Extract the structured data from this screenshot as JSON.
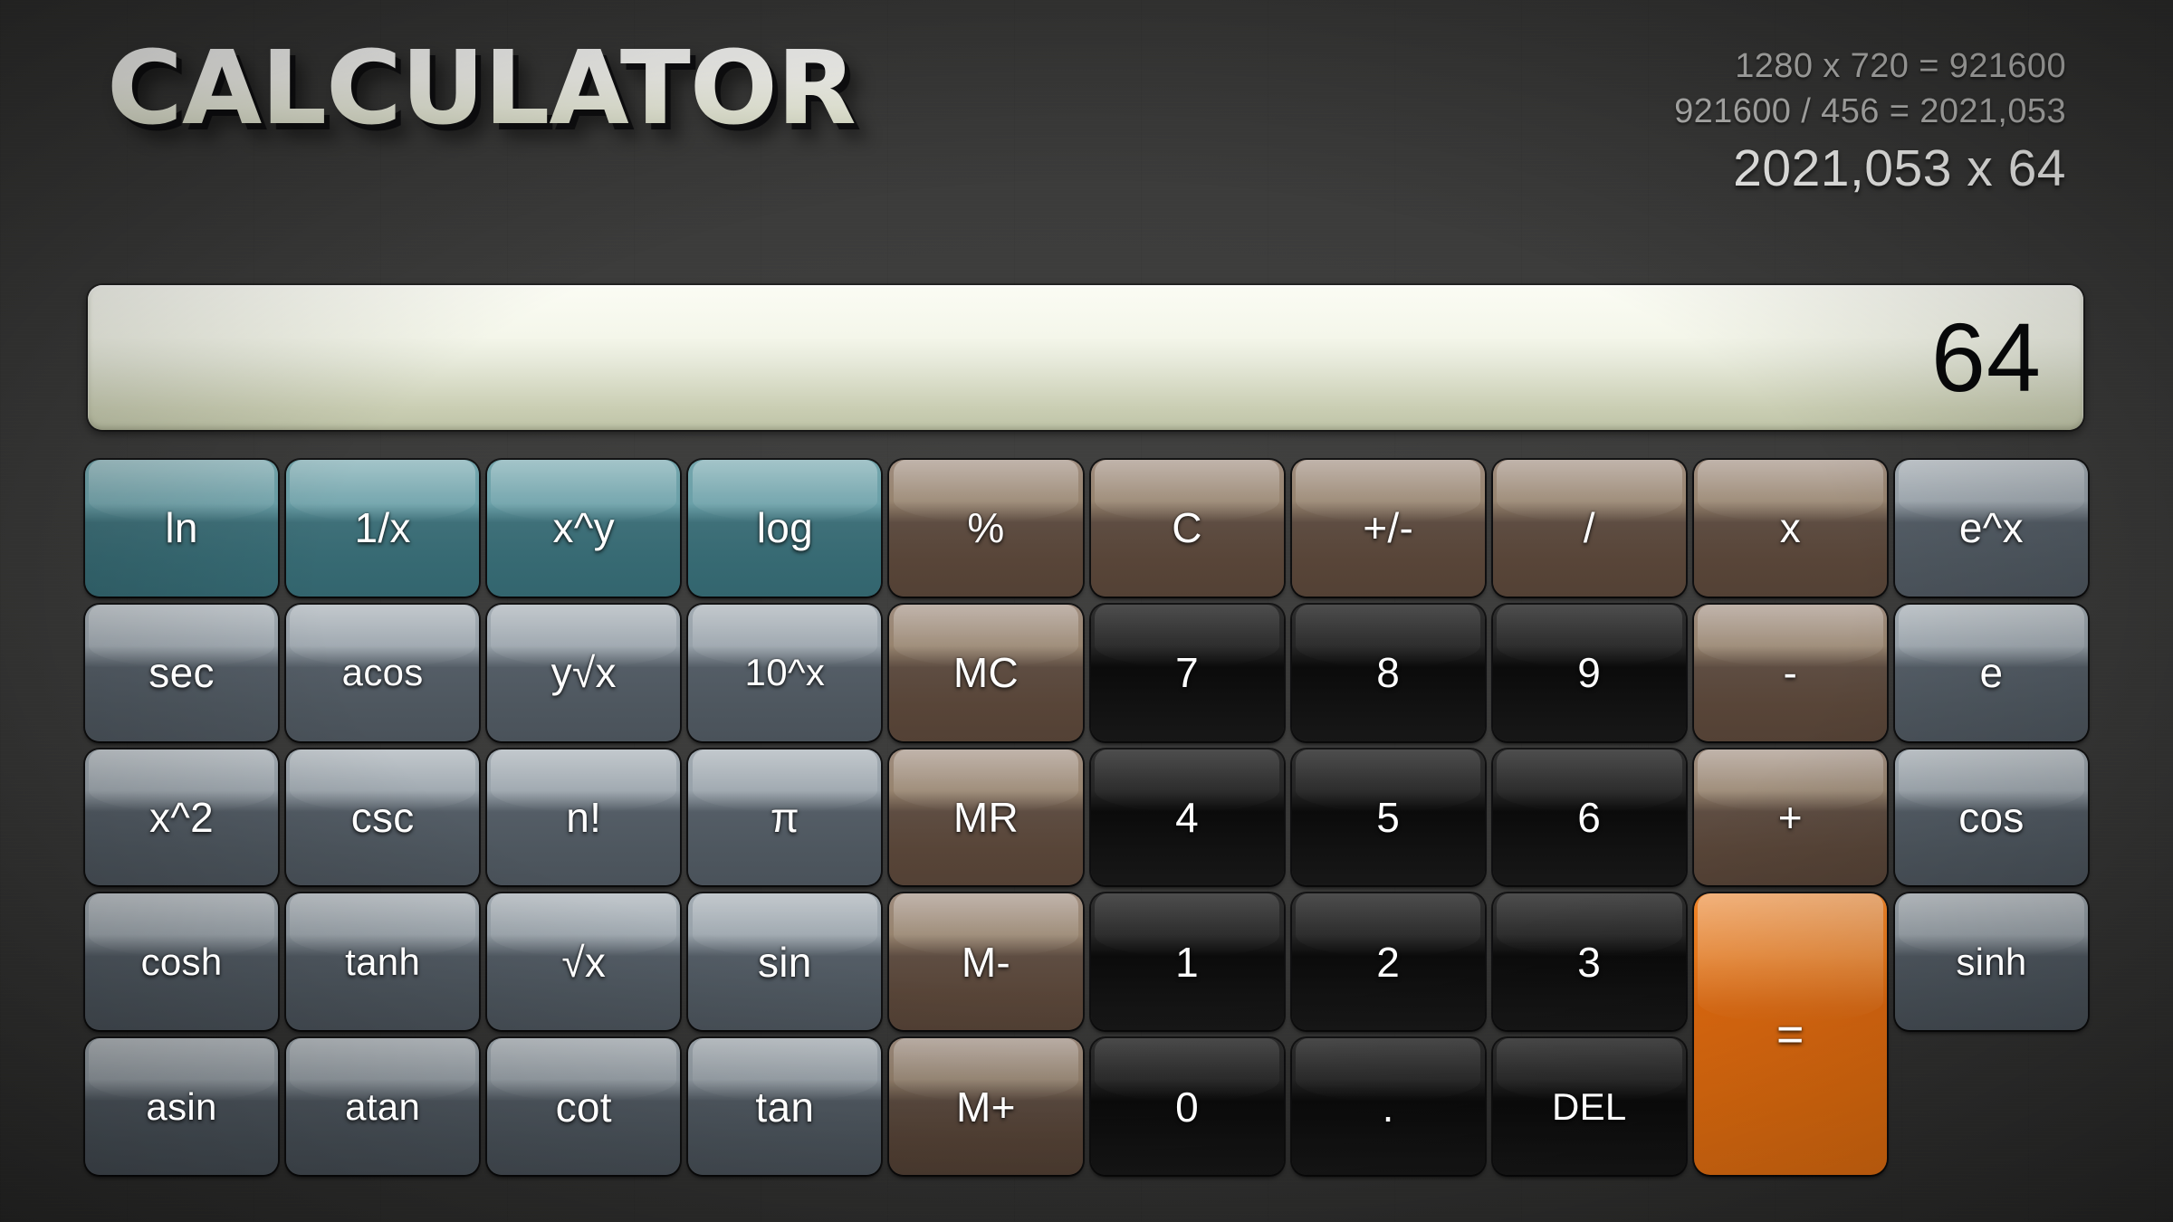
{
  "header": {
    "title": "CALCULATOR",
    "history": [
      "1280 x 720 = 921600",
      "921600 / 456 = 2021,053"
    ],
    "current_expression": "2021,053 x 64"
  },
  "display": {
    "value": "64"
  },
  "colors": {
    "background": "#3a3a39",
    "display_light": "#fbfcf4",
    "display_dark": "#bfc4a8",
    "teal": "#3f7079",
    "brown": "#5e4d42",
    "slate": "#545d66",
    "dark": "#111111",
    "orange": "#ef7411",
    "key_text": "#ffffff"
  },
  "keypad": {
    "rows": [
      [
        {
          "label": "ln",
          "name": "key-ln",
          "style": "teal"
        },
        {
          "label": "1/x",
          "name": "key-reciprocal",
          "style": "teal"
        },
        {
          "label": "x^y",
          "name": "key-power",
          "style": "teal"
        },
        {
          "label": "log",
          "name": "key-log",
          "style": "teal"
        },
        {
          "label": "%",
          "name": "key-percent",
          "style": "brown"
        },
        {
          "label": "C",
          "name": "key-clear",
          "style": "brown"
        },
        {
          "label": "+/-",
          "name": "key-sign",
          "style": "brown"
        },
        {
          "label": "/",
          "name": "key-divide",
          "style": "brown"
        },
        {
          "label": "x",
          "name": "key-multiply",
          "style": "brown"
        }
      ],
      [
        {
          "label": "e^x",
          "name": "key-exp",
          "style": "slate"
        },
        {
          "label": "sec",
          "name": "key-sec",
          "style": "slate"
        },
        {
          "label": "acos",
          "name": "key-acos",
          "style": "slate",
          "small": true
        },
        {
          "label": "y√x",
          "name": "key-nth-root",
          "style": "slate"
        },
        {
          "label": "10^x",
          "name": "key-ten-power",
          "style": "slate",
          "small": true
        },
        {
          "label": "MC",
          "name": "key-memory-clear",
          "style": "brown"
        },
        {
          "label": "7",
          "name": "key-7",
          "style": "dark"
        },
        {
          "label": "8",
          "name": "key-8",
          "style": "dark"
        },
        {
          "label": "9",
          "name": "key-9",
          "style": "dark"
        },
        {
          "label": "-",
          "name": "key-minus",
          "style": "brown"
        }
      ],
      [
        {
          "label": "e",
          "name": "key-euler",
          "style": "slate"
        },
        {
          "label": "x^2",
          "name": "key-square",
          "style": "slate"
        },
        {
          "label": "csc",
          "name": "key-csc",
          "style": "slate"
        },
        {
          "label": "n!",
          "name": "key-factorial",
          "style": "slate"
        },
        {
          "label": "π",
          "name": "key-pi",
          "style": "slate"
        },
        {
          "label": "MR",
          "name": "key-memory-recall",
          "style": "brown"
        },
        {
          "label": "4",
          "name": "key-4",
          "style": "dark"
        },
        {
          "label": "5",
          "name": "key-5",
          "style": "dark"
        },
        {
          "label": "6",
          "name": "key-6",
          "style": "dark"
        },
        {
          "label": "+",
          "name": "key-plus",
          "style": "brown"
        }
      ],
      [
        {
          "label": "cos",
          "name": "key-cos",
          "style": "slate"
        },
        {
          "label": "cosh",
          "name": "key-cosh",
          "style": "slate",
          "small": true
        },
        {
          "label": "tanh",
          "name": "key-tanh",
          "style": "slate",
          "small": true
        },
        {
          "label": "√x",
          "name": "key-sqrt",
          "style": "slate"
        },
        {
          "label": "sin",
          "name": "key-sin",
          "style": "slate"
        },
        {
          "label": "M-",
          "name": "key-memory-subtract",
          "style": "brown"
        },
        {
          "label": "1",
          "name": "key-1",
          "style": "dark"
        },
        {
          "label": "2",
          "name": "key-2",
          "style": "dark"
        },
        {
          "label": "3",
          "name": "key-3",
          "style": "dark"
        },
        {
          "label": "=",
          "name": "key-equals",
          "style": "orange",
          "tall": true
        }
      ],
      [
        {
          "label": "sinh",
          "name": "key-sinh",
          "style": "slate",
          "small": true
        },
        {
          "label": "asin",
          "name": "key-asin",
          "style": "slate",
          "small": true
        },
        {
          "label": "atan",
          "name": "key-atan",
          "style": "slate",
          "small": true
        },
        {
          "label": "cot",
          "name": "key-cot",
          "style": "slate"
        },
        {
          "label": "tan",
          "name": "key-tan",
          "style": "slate"
        },
        {
          "label": "M+",
          "name": "key-memory-add",
          "style": "brown"
        },
        {
          "label": "0",
          "name": "key-0",
          "style": "dark"
        },
        {
          "label": ".",
          "name": "key-decimal",
          "style": "dark"
        },
        {
          "label": "DEL",
          "name": "key-delete",
          "style": "dark",
          "small": true
        }
      ]
    ]
  }
}
